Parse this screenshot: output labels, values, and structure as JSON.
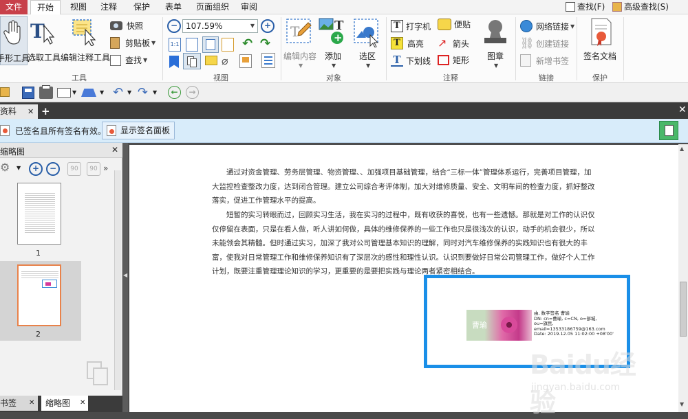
{
  "menu": {
    "file": "文件",
    "tabs": [
      "开始",
      "视图",
      "注释",
      "保护",
      "表单",
      "页面组织",
      "审阅"
    ],
    "search": "查找(F)",
    "advanced_search": "高级查找(S)"
  },
  "ribbon": {
    "tools": {
      "hand": "手形工具",
      "select": "选取工具",
      "edit_annot": "编辑注释工具",
      "label": "工具"
    },
    "clipboard": {
      "snapshot": "快照",
      "clipboard": "剪贴板",
      "find": "查找"
    },
    "view": {
      "zoom": "107.59%",
      "label": "视图"
    },
    "objects": {
      "edit_content": "编辑内容",
      "add": "添加",
      "select_area": "选区",
      "label": "对象"
    },
    "annotations": {
      "typewriter": "打字机",
      "note": "便贴",
      "highlight": "高亮",
      "arrow": "箭头",
      "underline": "下划线",
      "rect": "矩形",
      "stamp": "图章",
      "label": "注释"
    },
    "links": {
      "web_link": "网络链接",
      "create_link": "创建链接",
      "new_bookmark": "新增书签",
      "label": "链接"
    },
    "protect": {
      "sign": "签名文档",
      "label": "保护"
    }
  },
  "doc_tab": {
    "title": "资料"
  },
  "signature_bar": {
    "status": "已签名且所有签名有效。",
    "show_panel": "显示签名面板"
  },
  "sidebar": {
    "title": "缩略图",
    "pages": [
      {
        "number": "1",
        "selected": false
      },
      {
        "number": "2",
        "selected": true
      }
    ],
    "bottom_tabs": [
      "书签",
      "缩略图"
    ]
  },
  "document": {
    "paragraphs": [
      "通过对资金管理、劳务层管理、物资管理、、加强项目基础管理，结合“三标一体”管理体系运行，完善项目管理，加大监控检查整改力度，达到闭合管理。建立公司综合考评体制，加大对维修质量、安全、文明车间的检查力度，抓好整改落实，促进工作管理水平的提高。",
      "短暂的实习转眼而过，回顾实习生活，我在实习的过程中，既有收获的喜悦，也有一些遗憾。那就是对工作的认识仅仅停留在表面，只是在看人做，听人讲如何做，具体的维修保养的一些工作也只是很浅次的认识，动手的机会很少，所以未能领会其精髓。但时通过实习，加深了我对公司管理基本知识的理解，同时对汽车维修保养的实践知识也有很大的丰富，使我对日常管理工作和维修保养知识有了深层次的感性和理性认识。认识到要做好日常公司管理工作，做好个人工作计划，既要注重管理理论知识的学习，更重要的是要把实践与理论两者紧密相结合。"
    ],
    "signature": {
      "stamp_text": "曹瑜",
      "lines": [
        "由, 数字签名 曹瑜",
        "DN: cn=曹瑜, c=CN, o=部城,",
        "ou=旗民,",
        "email=13533186759@163.com",
        "Date: 2019.12.05 11:02:00 +08'00'"
      ]
    }
  },
  "watermark": {
    "brand": "Baidu经验",
    "url": "jingyan.baidu.com"
  },
  "colors": {
    "file_tab": "#c8404a",
    "highlight_box": "#1a8fe8",
    "sig_bar": "#d8ecfa",
    "thumb_selected": "#e8824a"
  }
}
